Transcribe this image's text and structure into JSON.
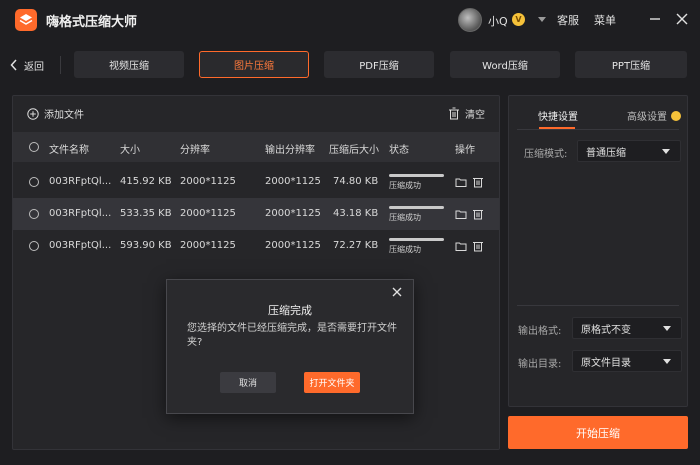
{
  "app": {
    "title": "嗨格式压缩大师"
  },
  "user": {
    "name": "小Q",
    "vip_mark": "V"
  },
  "header": {
    "service_label": "客服",
    "menu_label": "菜单"
  },
  "nav": {
    "back_label": "返回",
    "tabs": [
      {
        "label": "视频压缩"
      },
      {
        "label": "图片压缩",
        "active": true
      },
      {
        "label": "PDF压缩"
      },
      {
        "label": "Word压缩"
      },
      {
        "label": "PPT压缩"
      }
    ]
  },
  "file_panel": {
    "add_label": "添加文件",
    "clear_label": "清空",
    "columns": [
      "文件名称",
      "大小",
      "分辨率",
      "输出分辨率",
      "压缩后大小",
      "状态",
      "操作"
    ],
    "rows": [
      {
        "name": "003RFptQl...",
        "size": "415.92 KB",
        "res": "2000*1125",
        "out_res": "2000*1125",
        "out_size": "74.80 KB",
        "status": "压缩成功",
        "progress": 1.0
      },
      {
        "name": "003RFptQl...",
        "size": "533.35 KB",
        "res": "2000*1125",
        "out_res": "2000*1125",
        "out_size": "43.18 KB",
        "status": "压缩成功",
        "progress": 1.0
      },
      {
        "name": "003RFptQl...",
        "size": "593.90 KB",
        "res": "2000*1125",
        "out_res": "2000*1125",
        "out_size": "72.27 KB",
        "status": "压缩成功",
        "progress": 1.0
      }
    ]
  },
  "settings": {
    "tab_quick": "快捷设置",
    "tab_advanced": "高级设置",
    "mode_label": "压缩模式:",
    "mode_value": "普通压缩",
    "format_label": "输出格式:",
    "format_value": "原格式不变",
    "dir_label": "输出目录:",
    "dir_value": "原文件目录"
  },
  "start_label": "开始压缩",
  "dialog": {
    "title": "压缩完成",
    "message": "您选择的文件已经压缩完成，是否需要打开文件夹?",
    "cancel_label": "取消",
    "open_label": "打开文件夹"
  },
  "colors": {
    "accent": "#ff6a2b",
    "background": "#1e1e21",
    "panel": "#262629"
  }
}
